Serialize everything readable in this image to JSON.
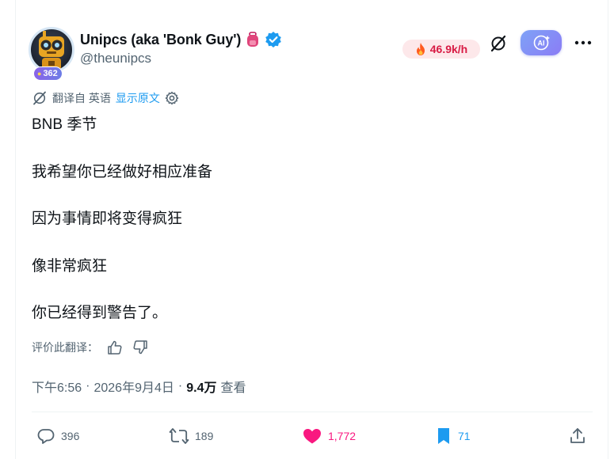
{
  "author": {
    "display_name": "Unipcs (aka 'Bonk Guy')",
    "handle": "@theunipcs",
    "level": "362",
    "verified": true
  },
  "trend": {
    "rate": "46.9k/h",
    "color": "#d81b44"
  },
  "translation": {
    "from_text": "翻译自 英语",
    "show_original": "显示原文"
  },
  "tweet_lines": [
    "BNB 季节",
    "我希望你已经做好相应准备",
    "因为事情即将变得疯狂",
    "像非常疯狂",
    "你已经得到警告了。"
  ],
  "rate_translation_label": "评价此翻译：",
  "meta": {
    "time": "下午6:56",
    "date": "2026年9月4日",
    "views_count": "9.4万",
    "views_label": "查看"
  },
  "actions": {
    "replies": "396",
    "reposts": "189",
    "likes": "1,772",
    "bookmarks": "71"
  },
  "icons": {
    "ai": "AI",
    "more": "more-icon",
    "hide": "slash-icon"
  },
  "colors": {
    "like": "#f91880",
    "bookmark": "#1d9bf0",
    "link": "#1d9bf0",
    "muted": "#536471"
  }
}
